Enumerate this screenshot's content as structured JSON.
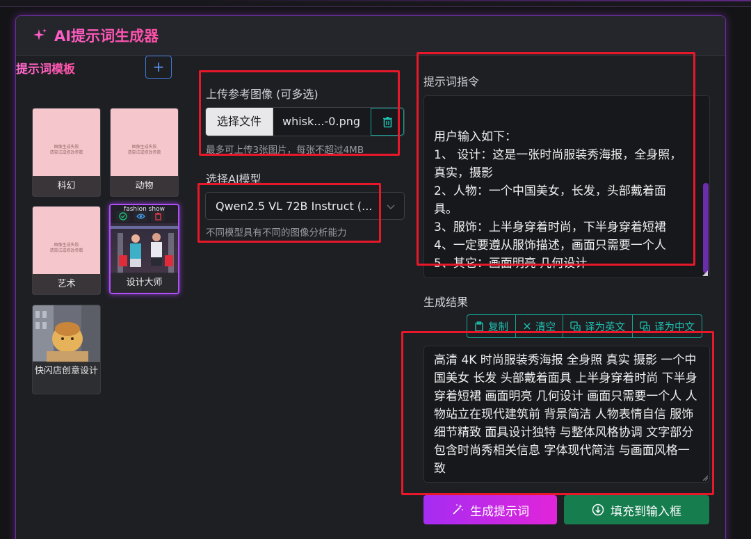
{
  "app": {
    "title": "AI提示词生成器"
  },
  "templates": {
    "heading": "提示词模板",
    "add_label": "+",
    "placeholder_text_line1": "图像生成失败",
    "placeholder_text_line2": "请尝试或修改参数",
    "items": [
      {
        "label": "科幻"
      },
      {
        "label": "动物"
      },
      {
        "label": "艺术"
      },
      {
        "label": "设计大师",
        "overlay_title": "fashion show"
      },
      {
        "label": "快闪店创意设计"
      }
    ]
  },
  "upload": {
    "label": "上传参考图像 (可多选)",
    "choose_button": "选择文件",
    "file_name": "whisk...-0.png",
    "hint": "最多可上传3张图片，每张不超过4MB"
  },
  "model": {
    "label": "选择AI模型",
    "selected": "Qwen2.5 VL 72B Instruct (...",
    "hint": "不同模型具有不同的图像分析能力"
  },
  "instruction": {
    "label": "提示词指令",
    "lines": [
      "用户输入如下：",
      "1、 设计：这是一张时尚服装秀海报，全身照，",
      "真实，摄影",
      "2、人物：一个中国美女，长发，头部戴着面",
      "具。",
      "3、服饰：上半身穿着时尚，下半身穿着短裙",
      "4、一定要遵从服饰描述，画面只需要一个人",
      "5、其它：画面明亮 几何设计"
    ]
  },
  "result": {
    "label": "生成结果",
    "tools": {
      "copy": "复制",
      "clear": "清空",
      "to_english": "译为英文",
      "to_chinese": "译为中文"
    },
    "lines": [
      "高清 4K 时尚服装秀海报 全身照 真实 摄影 一个中",
      "国美女 长发 头部戴着面具 上半身穿着时尚 下半身",
      "穿着短裙 画面明亮 几何设计 画面只需要一个人 人",
      "物站立在现代建筑前 背景简洁 人物表情自信 服饰",
      "细节精致 面具设计独特 与整体风格协调 文字部分",
      "包含时尚秀相关信息 字体现代简洁 与画面风格一",
      "致"
    ]
  },
  "actions": {
    "generate": "生成提示词",
    "fill": "填充到输入框"
  },
  "colors": {
    "accent_purple": "#b14cff",
    "accent_pink": "#ff5fc8",
    "teal": "#1fc0b1",
    "annotation_red": "#e8182a",
    "green": "#167d4f"
  }
}
